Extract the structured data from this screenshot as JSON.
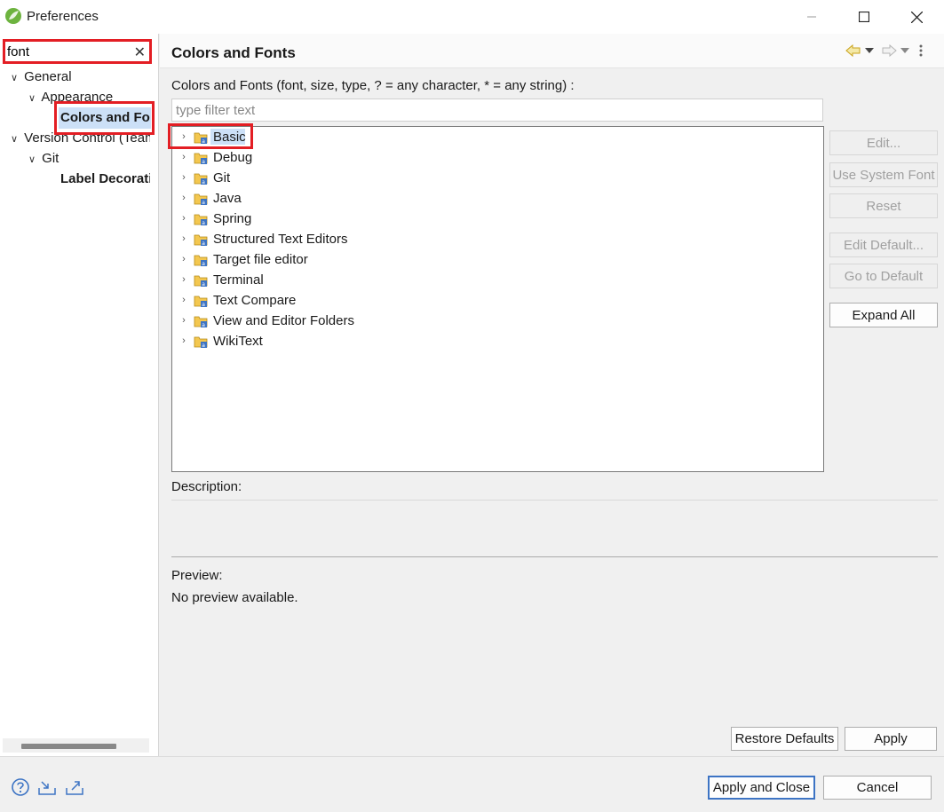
{
  "window": {
    "title": "Preferences"
  },
  "left": {
    "search_value": "font",
    "search_clear": "✕",
    "tree": [
      {
        "label": "General",
        "level": 0
      },
      {
        "label": "Appearance",
        "level": 1
      },
      {
        "label": "Colors and Fonts",
        "level": 2
      },
      {
        "label": "Version Control (Team)",
        "level": 0
      },
      {
        "label": "Git",
        "level": 1
      },
      {
        "label": "Label Decorations",
        "level": 2
      }
    ]
  },
  "main": {
    "title": "Colors and Fonts",
    "section_label": "Colors and Fonts (font, size, type, ? = any character, * = any string) :",
    "filter_placeholder": "type filter text",
    "categories": [
      "Basic",
      "Debug",
      "Git",
      "Java",
      "Spring",
      "Structured Text Editors",
      "Target file editor",
      "Terminal",
      "Text Compare",
      "View and Editor Folders",
      "WikiText"
    ],
    "buttons": {
      "edit": "Edit...",
      "use_system_font": "Use System Font",
      "reset": "Reset",
      "edit_default": "Edit Default...",
      "go_to_default": "Go to Default",
      "expand_all": "Expand All"
    },
    "description_label": "Description:",
    "preview_label": "Preview:",
    "preview_text": "No preview available.",
    "restore_defaults": "Restore Defaults",
    "apply": "Apply"
  },
  "footer": {
    "apply_and_close": "Apply and Close",
    "cancel": "Cancel"
  },
  "colors": {
    "highlight": "#e31e24",
    "selection": "#cce0f7"
  }
}
